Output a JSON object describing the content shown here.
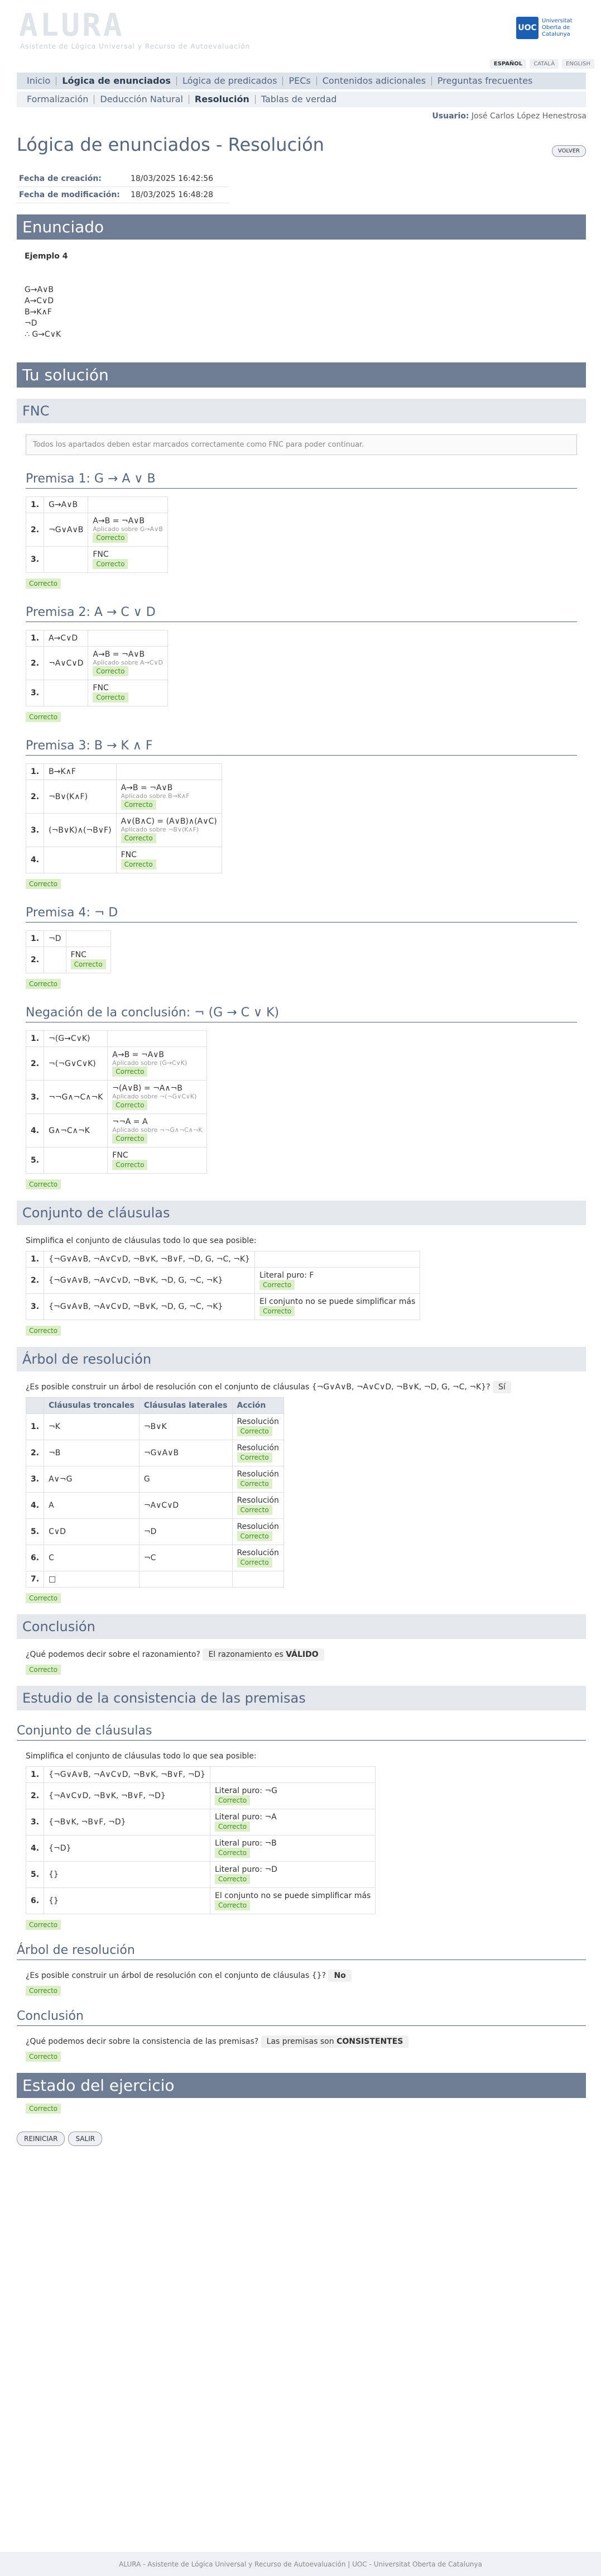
{
  "app": {
    "logo": "ALURA",
    "subtitle": "Asistente de Lógica Universal y Recurso de Autoevaluación",
    "uoc_mark": "UOC",
    "uoc_text": "Universitat Oberta de Catalunya"
  },
  "langs": [
    "ESPAÑOL",
    "CATALÀ",
    "ENGLISH"
  ],
  "nav1": [
    "Inicio",
    "Lógica de enunciados",
    "Lógica de predicados",
    "PECs",
    "Contenidos adicionales",
    "Preguntas frecuentes"
  ],
  "nav2": [
    "Formalización",
    "Deducción Natural",
    "Resolución",
    "Tablas de verdad"
  ],
  "user": {
    "label": "Usuario:",
    "name": "José Carlos López Henestrosa"
  },
  "page": {
    "title": "Lógica de enunciados - Resolución",
    "volver": "VOLVER",
    "creation_label": "Fecha de creación:",
    "creation": "18/03/2025 16:42:56",
    "mod_label": "Fecha de modificación:",
    "mod": "18/03/2025 16:48:28"
  },
  "enunciado": {
    "header": "Enunciado",
    "example": "Ejemplo 4",
    "lines": [
      "G→A∨B",
      "A→C∨D",
      "B→K∧F",
      "¬D",
      "∴ G→C∨K"
    ]
  },
  "solution": {
    "header": "Tu solución",
    "fnc": "FNC",
    "note": "Todos los apartados deben estar marcados correctamente como FNC para poder continuar.",
    "correct": "Correcto"
  },
  "premises": [
    {
      "title": "Premisa 1: G → A ∨ B",
      "rows": [
        [
          "1.",
          "G→A∨B",
          "",
          ""
        ],
        [
          "2.",
          "¬G∨A∨B",
          "A→B = ¬A∨B",
          "Aplicado sobre G→A∨B"
        ],
        [
          "3.",
          "",
          "FNC",
          ""
        ]
      ]
    },
    {
      "title": "Premisa 2: A → C ∨ D",
      "rows": [
        [
          "1.",
          "A→C∨D",
          "",
          ""
        ],
        [
          "2.",
          "¬A∨C∨D",
          "A→B = ¬A∨B",
          "Aplicado sobre A→C∨D"
        ],
        [
          "3.",
          "",
          "FNC",
          ""
        ]
      ]
    },
    {
      "title": "Premisa 3: B → K ∧ F",
      "rows": [
        [
          "1.",
          "B→K∧F",
          "",
          ""
        ],
        [
          "2.",
          "¬B∨(K∧F)",
          "A→B = ¬A∨B",
          "Aplicado sobre B→K∧F"
        ],
        [
          "3.",
          "(¬B∨K)∧(¬B∨F)",
          "A∨(B∧C) = (A∨B)∧(A∨C)",
          "Aplicado sobre ¬B∨(K∧F)"
        ],
        [
          "4.",
          "",
          "FNC",
          ""
        ]
      ]
    },
    {
      "title": "Premisa 4: ¬ D",
      "rows": [
        [
          "1.",
          "¬D",
          "",
          ""
        ],
        [
          "2.",
          "",
          "FNC",
          ""
        ]
      ]
    },
    {
      "title": "Negación de la conclusión: ¬ (G → C ∨ K)",
      "rows": [
        [
          "1.",
          "¬(G→C∨K)",
          "",
          ""
        ],
        [
          "2.",
          "¬(¬G∨C∨K)",
          "A→B = ¬A∨B",
          "Aplicado sobre (G→C∨K)"
        ],
        [
          "3.",
          "¬¬G∧¬C∧¬K",
          "¬(A∨B) = ¬A∧¬B",
          "Aplicado sobre ¬(¬G∨C∨K)"
        ],
        [
          "4.",
          "G∧¬C∧¬K",
          "¬¬A = A",
          "Aplicado sobre ¬¬G∧¬C∧¬K"
        ],
        [
          "5.",
          "",
          "FNC",
          ""
        ]
      ]
    }
  ],
  "clauses": {
    "header": "Conjunto de cláusulas",
    "intro": "Simplifica el conjunto de cláusulas todo lo que sea posible:",
    "rows": [
      [
        "1.",
        "{¬G∨A∨B, ¬A∨C∨D, ¬B∨K, ¬B∨F, ¬D, G, ¬C, ¬K}",
        ""
      ],
      [
        "2.",
        "{¬G∨A∨B, ¬A∨C∨D, ¬B∨K, ¬D, G, ¬C, ¬K}",
        "Literal puro: F"
      ],
      [
        "3.",
        "{¬G∨A∨B, ¬A∨C∨D, ¬B∨K, ¬D, G, ¬C, ¬K}",
        "El conjunto no se puede simplificar más"
      ]
    ]
  },
  "tree": {
    "header": "Árbol de resolución",
    "question": "¿Es posible construir un árbol de resolución con el conjunto de cláusulas {¬G∨A∨B, ¬A∨C∨D, ¬B∨K, ¬D, G, ¬C, ¬K}?",
    "answer": "Sí",
    "cols": [
      "Cláusulas troncales",
      "Cláusulas laterales",
      "Acción"
    ],
    "rows": [
      [
        "1.",
        "¬K",
        "¬B∨K",
        "Resolución"
      ],
      [
        "2.",
        "¬B",
        "¬G∨A∨B",
        "Resolución"
      ],
      [
        "3.",
        "A∨¬G",
        "G",
        "Resolución"
      ],
      [
        "4.",
        "A",
        "¬A∨C∨D",
        "Resolución"
      ],
      [
        "5.",
        "C∨D",
        "¬D",
        "Resolución"
      ],
      [
        "6.",
        "C",
        "¬C",
        "Resolución"
      ],
      [
        "7.",
        "□",
        "",
        ""
      ]
    ]
  },
  "conclusion": {
    "header": "Conclusión",
    "question": "¿Qué podemos decir sobre el razonamiento?",
    "answer_pre": "El razonamiento es",
    "answer": "VÁLIDO"
  },
  "consistency": {
    "header": "Estudio de la consistencia de las premisas",
    "clauses_title": "Conjunto de cláusulas",
    "intro": "Simplifica el conjunto de cláusulas todo lo que sea posible:",
    "rows": [
      [
        "1.",
        "{¬G∨A∨B, ¬A∨C∨D, ¬B∨K, ¬B∨F, ¬D}",
        ""
      ],
      [
        "2.",
        "{¬A∨C∨D, ¬B∨K, ¬B∨F, ¬D}",
        "Literal puro: ¬G"
      ],
      [
        "3.",
        "{¬B∨K, ¬B∨F, ¬D}",
        "Literal puro: ¬A"
      ],
      [
        "4.",
        "{¬D}",
        "Literal puro: ¬B"
      ],
      [
        "5.",
        "{}",
        "Literal puro: ¬D"
      ],
      [
        "6.",
        "{}",
        "El conjunto no se puede simplificar más"
      ]
    ],
    "tree_title": "Árbol de resolución",
    "tree_q": "¿Es posible construir un árbol de resolución con el conjunto de cláusulas {}?",
    "tree_a": "No",
    "concl_title": "Conclusión",
    "concl_q": "¿Qué podemos decir sobre la consistencia de las premisas?",
    "concl_pre": "Las premisas son",
    "concl_a": "CONSISTENTES"
  },
  "state": {
    "header": "Estado del ejercicio"
  },
  "buttons": {
    "reset": "REINICIAR",
    "exit": "SALIR"
  },
  "footer": "ALURA - Asistente de Lógica Universal y Recurso de Autoevaluación | UOC - Universitat Oberta de Catalunya"
}
